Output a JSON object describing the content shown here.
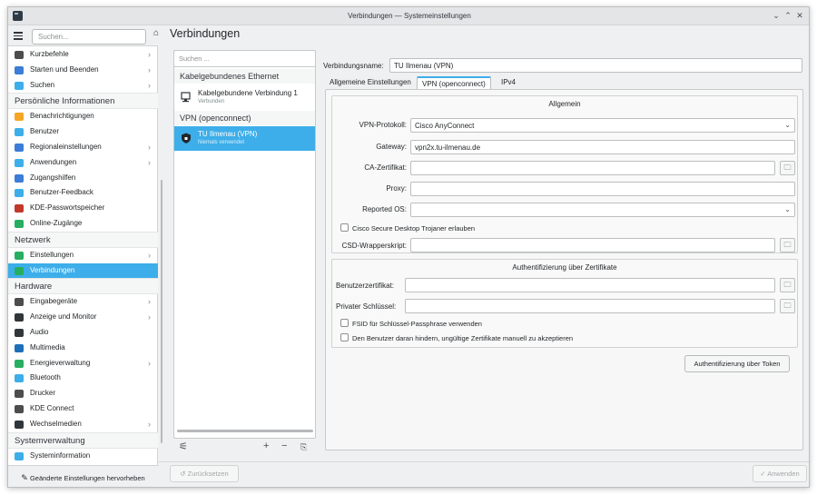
{
  "window": {
    "title": "Verbindungen — Systemeinstellungen"
  },
  "sidebar": {
    "search_placeholder": "Suchen...",
    "footer_label": "Geänderte Einstellungen hervorheben",
    "items": [
      {
        "label": "Kurzbefehle",
        "icon": "keyboard-icon",
        "chevron": true,
        "color": "#4d4d4d"
      },
      {
        "label": "Starten und Beenden",
        "icon": "monitor-icon",
        "chevron": true,
        "color": "#3b7dd8"
      },
      {
        "label": "Suchen",
        "icon": "search-icon",
        "chevron": true,
        "color": "#3daee9"
      },
      {
        "category": "Persönliche Informationen"
      },
      {
        "label": "Benachrichtigungen",
        "icon": "bell-icon",
        "chevron": false,
        "color": "#f6a623"
      },
      {
        "label": "Benutzer",
        "icon": "user-icon",
        "chevron": false,
        "color": "#3daee9"
      },
      {
        "label": "Regionaleinstellungen",
        "icon": "flag-icon",
        "chevron": true,
        "color": "#3b7dd8"
      },
      {
        "label": "Anwendungen",
        "icon": "apps-icon",
        "chevron": true,
        "color": "#3daee9"
      },
      {
        "label": "Zugangshilfen",
        "icon": "accessibility-icon",
        "chevron": false,
        "color": "#3b7dd8"
      },
      {
        "label": "Benutzer-Feedback",
        "icon": "feedback-icon",
        "chevron": false,
        "color": "#3daee9"
      },
      {
        "label": "KDE-Passwortspeicher",
        "icon": "wallet-icon",
        "chevron": false,
        "color": "#c0392b"
      },
      {
        "label": "Online-Zugänge",
        "icon": "globe-icon",
        "chevron": false,
        "color": "#27ae60"
      },
      {
        "category": "Netzwerk"
      },
      {
        "label": "Einstellungen",
        "icon": "network-settings-icon",
        "chevron": true,
        "color": "#27ae60"
      },
      {
        "label": "Verbindungen",
        "icon": "network-connections-icon",
        "chevron": false,
        "color": "#27ae60",
        "active": true
      },
      {
        "category": "Hardware"
      },
      {
        "label": "Eingabegeräte",
        "icon": "input-devices-icon",
        "chevron": true,
        "color": "#4d4d4d"
      },
      {
        "label": "Anzeige und Monitor",
        "icon": "display-icon",
        "chevron": true,
        "color": "#31363b"
      },
      {
        "label": "Audio",
        "icon": "audio-icon",
        "chevron": false,
        "color": "#31363b"
      },
      {
        "label": "Multimedia",
        "icon": "multimedia-icon",
        "chevron": false,
        "color": "#1d6fb8"
      },
      {
        "label": "Energieverwaltung",
        "icon": "power-icon",
        "chevron": true,
        "color": "#27ae60"
      },
      {
        "label": "Bluetooth",
        "icon": "bluetooth-icon",
        "chevron": false,
        "color": "#3daee9"
      },
      {
        "label": "Drucker",
        "icon": "printer-icon",
        "chevron": false,
        "color": "#4d4d4d"
      },
      {
        "label": "KDE Connect",
        "icon": "phone-icon",
        "chevron": false,
        "color": "#4d4d4d"
      },
      {
        "label": "Wechselmedien",
        "icon": "usb-icon",
        "chevron": true,
        "color": "#31363b"
      },
      {
        "category": "Systemverwaltung"
      },
      {
        "label": "Systeminformation",
        "icon": "info-icon",
        "chevron": false,
        "color": "#3daee9"
      }
    ]
  },
  "page": {
    "title": "Verbindungen"
  },
  "connections": {
    "search_placeholder": "Suchen ...",
    "categories": [
      {
        "label": "Kabelgebundenes Ethernet",
        "items": [
          {
            "name": "Kabelgebundene Verbindung 1",
            "status": "Verbunden",
            "icon": "ethernet-icon"
          }
        ]
      },
      {
        "label": "VPN (openconnect)",
        "items": [
          {
            "name": "TU Ilmenau (VPN)",
            "status": "Niemals verwendet",
            "icon": "vpn-shield-icon",
            "active": true
          }
        ]
      }
    ]
  },
  "detail": {
    "connection_name_label": "Verbindungsname:",
    "connection_name_value": "TU Ilmenau (VPN)",
    "tabs": [
      "Allgemeine Einstellungen",
      "VPN (openconnect)",
      "IPv4"
    ],
    "active_tab": 1,
    "general_group": {
      "title": "Allgemein",
      "vpn_protocol_label": "VPN-Protokoll:",
      "vpn_protocol_value": "Cisco AnyConnect",
      "gateway_label": "Gateway:",
      "gateway_value": "vpn2x.tu-ilmenau.de",
      "ca_cert_label": "CA-Zertifikat:",
      "ca_cert_value": "",
      "proxy_label": "Proxy:",
      "proxy_value": "",
      "reported_os_label": "Reported OS:",
      "reported_os_value": "",
      "csd_checkbox_label": "Cisco Secure Desktop Trojaner erlauben",
      "csd_script_label": "CSD-Wrapperskript:",
      "csd_script_value": ""
    },
    "cert_group": {
      "title": "Authentifizierung über Zertifikate",
      "user_cert_label": "Benutzerzertifikat:",
      "user_cert_value": "",
      "private_key_label": "Privater Schlüssel:",
      "private_key_value": "",
      "fsid_label": "FSID für Schlüssel-Passphrase verwenden",
      "prevent_user_label": "Den Benutzer daran hindern, ungültige Zertifikate manuell zu akzeptieren"
    },
    "token_button": "Authentifizierung über Token"
  },
  "bottom": {
    "reset_label": "Zurücksetzen",
    "apply_label": "Anwenden"
  }
}
